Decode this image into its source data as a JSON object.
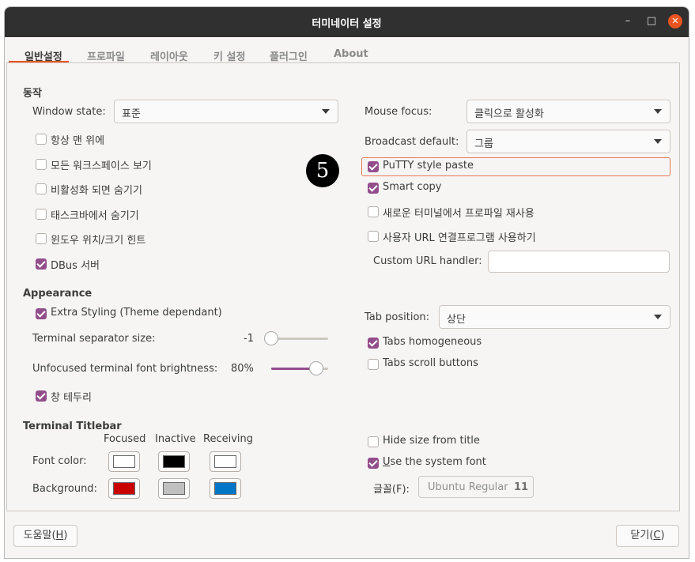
{
  "window": {
    "title": "터미네이터 설정",
    "minimize_glyph": "–",
    "maximize_glyph": "□",
    "close_glyph": "✕"
  },
  "tabs": [
    "일반설정",
    "프로파일",
    "레이아웃",
    "키 설정",
    "플러그인",
    "About"
  ],
  "behavior": {
    "section_title": "동작",
    "window_state_label": "Window state:",
    "window_state_value": "표준",
    "checkboxes": [
      {
        "label": "항상 맨 위에",
        "checked": false
      },
      {
        "label": "모든 워크스페이스 보기",
        "checked": false
      },
      {
        "label": "비활성화 되면 숨기기",
        "checked": false
      },
      {
        "label": "태스크바에서 숨기기",
        "checked": false
      },
      {
        "label": "윈도우 위치/크기 힌트",
        "checked": false
      },
      {
        "label": "DBus 서버",
        "checked": true
      }
    ],
    "mouse_focus_label": "Mouse focus:",
    "mouse_focus_value": "클릭으로 활성화",
    "broadcast_label": "Broadcast default:",
    "broadcast_value": "그룹",
    "right_checkboxes": [
      {
        "label": "PuTTY style paste",
        "checked": true
      },
      {
        "label": "Smart copy",
        "checked": true
      },
      {
        "label": "새로운 터미널에서 프로파일 재사용",
        "checked": false
      },
      {
        "label": "사용자 URL 연결프로그램 사용하기",
        "checked": false
      }
    ],
    "custom_url_label": "Custom URL handler:",
    "custom_url_value": ""
  },
  "appearance": {
    "section_title": "Appearance",
    "extra_styling_label": "Extra Styling (Theme dependant)",
    "extra_styling_checked": true,
    "separator_label": "Terminal separator size:",
    "separator_value": "-1",
    "separator_level": 0,
    "brightness_label": "Unfocused terminal font brightness:",
    "brightness_value": "80%",
    "brightness_level": 0.8,
    "border_label": "창 테두리",
    "border_checked": true,
    "tab_position_label": "Tab position:",
    "tab_position_value": "상단",
    "tabs_homogeneous_label": "Tabs homogeneous",
    "tabs_homogeneous_checked": true,
    "tabs_scroll_label": "Tabs scroll buttons",
    "tabs_scroll_checked": false
  },
  "titlebar": {
    "section_title": "Terminal Titlebar",
    "col_focused": "Focused",
    "col_inactive": "Inactive",
    "col_receiving": "Receiving",
    "font_color_label": "Font color:",
    "background_label": "Background:",
    "font_colors": [
      "#ffffff",
      "#000000",
      "#ffffff"
    ],
    "background_colors": [
      "#c80000",
      "#c0c0c0",
      "#0076c9"
    ],
    "hide_size_label": "Hide size from title",
    "hide_size_checked": false,
    "system_font_label_pre": "",
    "system_font_label_u": "U",
    "system_font_label_post": "se the system font",
    "system_font_checked": true,
    "font_label": "글꼴(F):",
    "font_name": "Ubuntu Regular",
    "font_size": "11"
  },
  "footer": {
    "help_pre": "도움말(",
    "help_u": "H",
    "help_post": ")",
    "close_pre": "닫기(",
    "close_u": "C",
    "close_post": ")"
  },
  "annotation_badge": "5",
  "colors": {
    "accent": "#e95420",
    "check": "#924d8b",
    "titlebar_bg": "#303030"
  }
}
